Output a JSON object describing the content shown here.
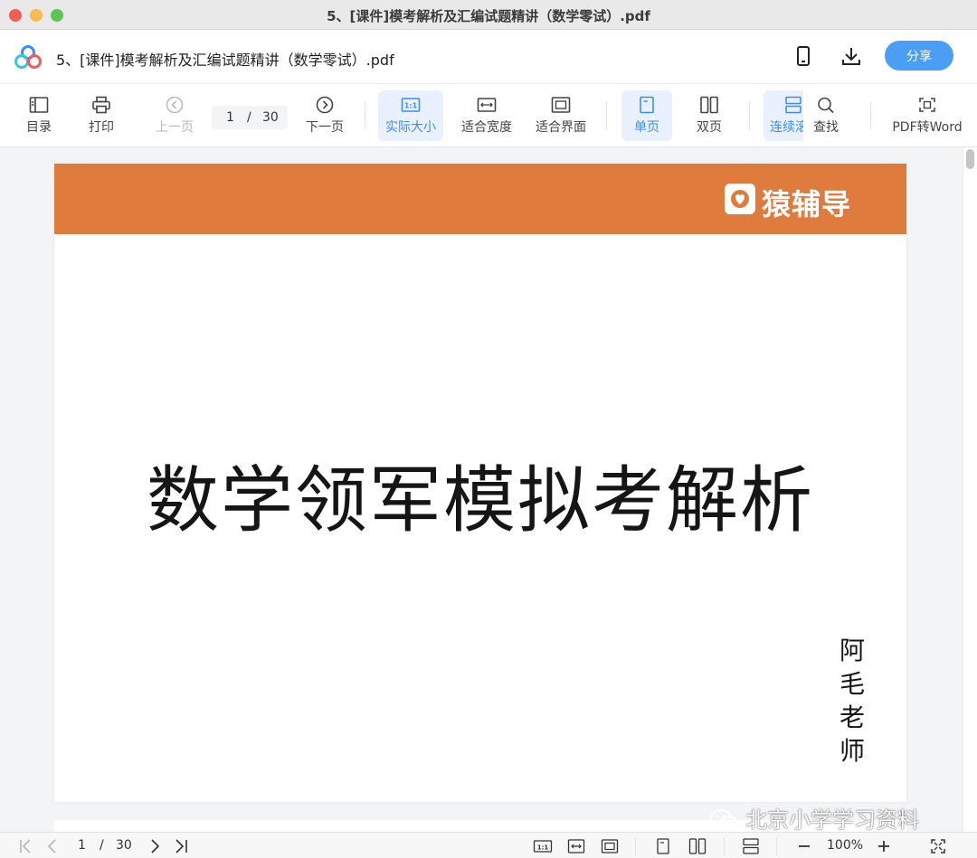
{
  "window": {
    "title": "5、[课件]模考解析及汇编试题精讲（数学零试）.pdf"
  },
  "header": {
    "doc_title": "5、[课件]模考解析及汇编试题精讲（数学零试）.pdf",
    "share_label": "分享",
    "icons": [
      "app-logo-icon",
      "mobile-icon",
      "download-icon"
    ]
  },
  "toolbar": {
    "toc": "目录",
    "print": "打印",
    "prev_page": "上一页",
    "current_page": "1",
    "page_sep": "/",
    "total_pages": "30",
    "next_page": "下一页",
    "actual_size": "实际大小",
    "fit_width": "适合宽度",
    "fit_screen": "适合界面",
    "single_page": "单页",
    "double_page": "双页",
    "continuous": "连续滚",
    "find": "查找",
    "pdf_to_word": "PDF转Word"
  },
  "page": {
    "brand_name": "猿辅导",
    "title": "数学领军模拟考解析",
    "author": "阿毛老师"
  },
  "statusbar": {
    "current_page": "1",
    "page_sep": "/",
    "total_pages": "30",
    "zoom": "100%"
  },
  "watermark": {
    "text": "北京小学学习资料"
  },
  "colors": {
    "accent": "#4a9ef5",
    "banner": "#e07b3e",
    "active_bg": "#e8f1fd"
  }
}
